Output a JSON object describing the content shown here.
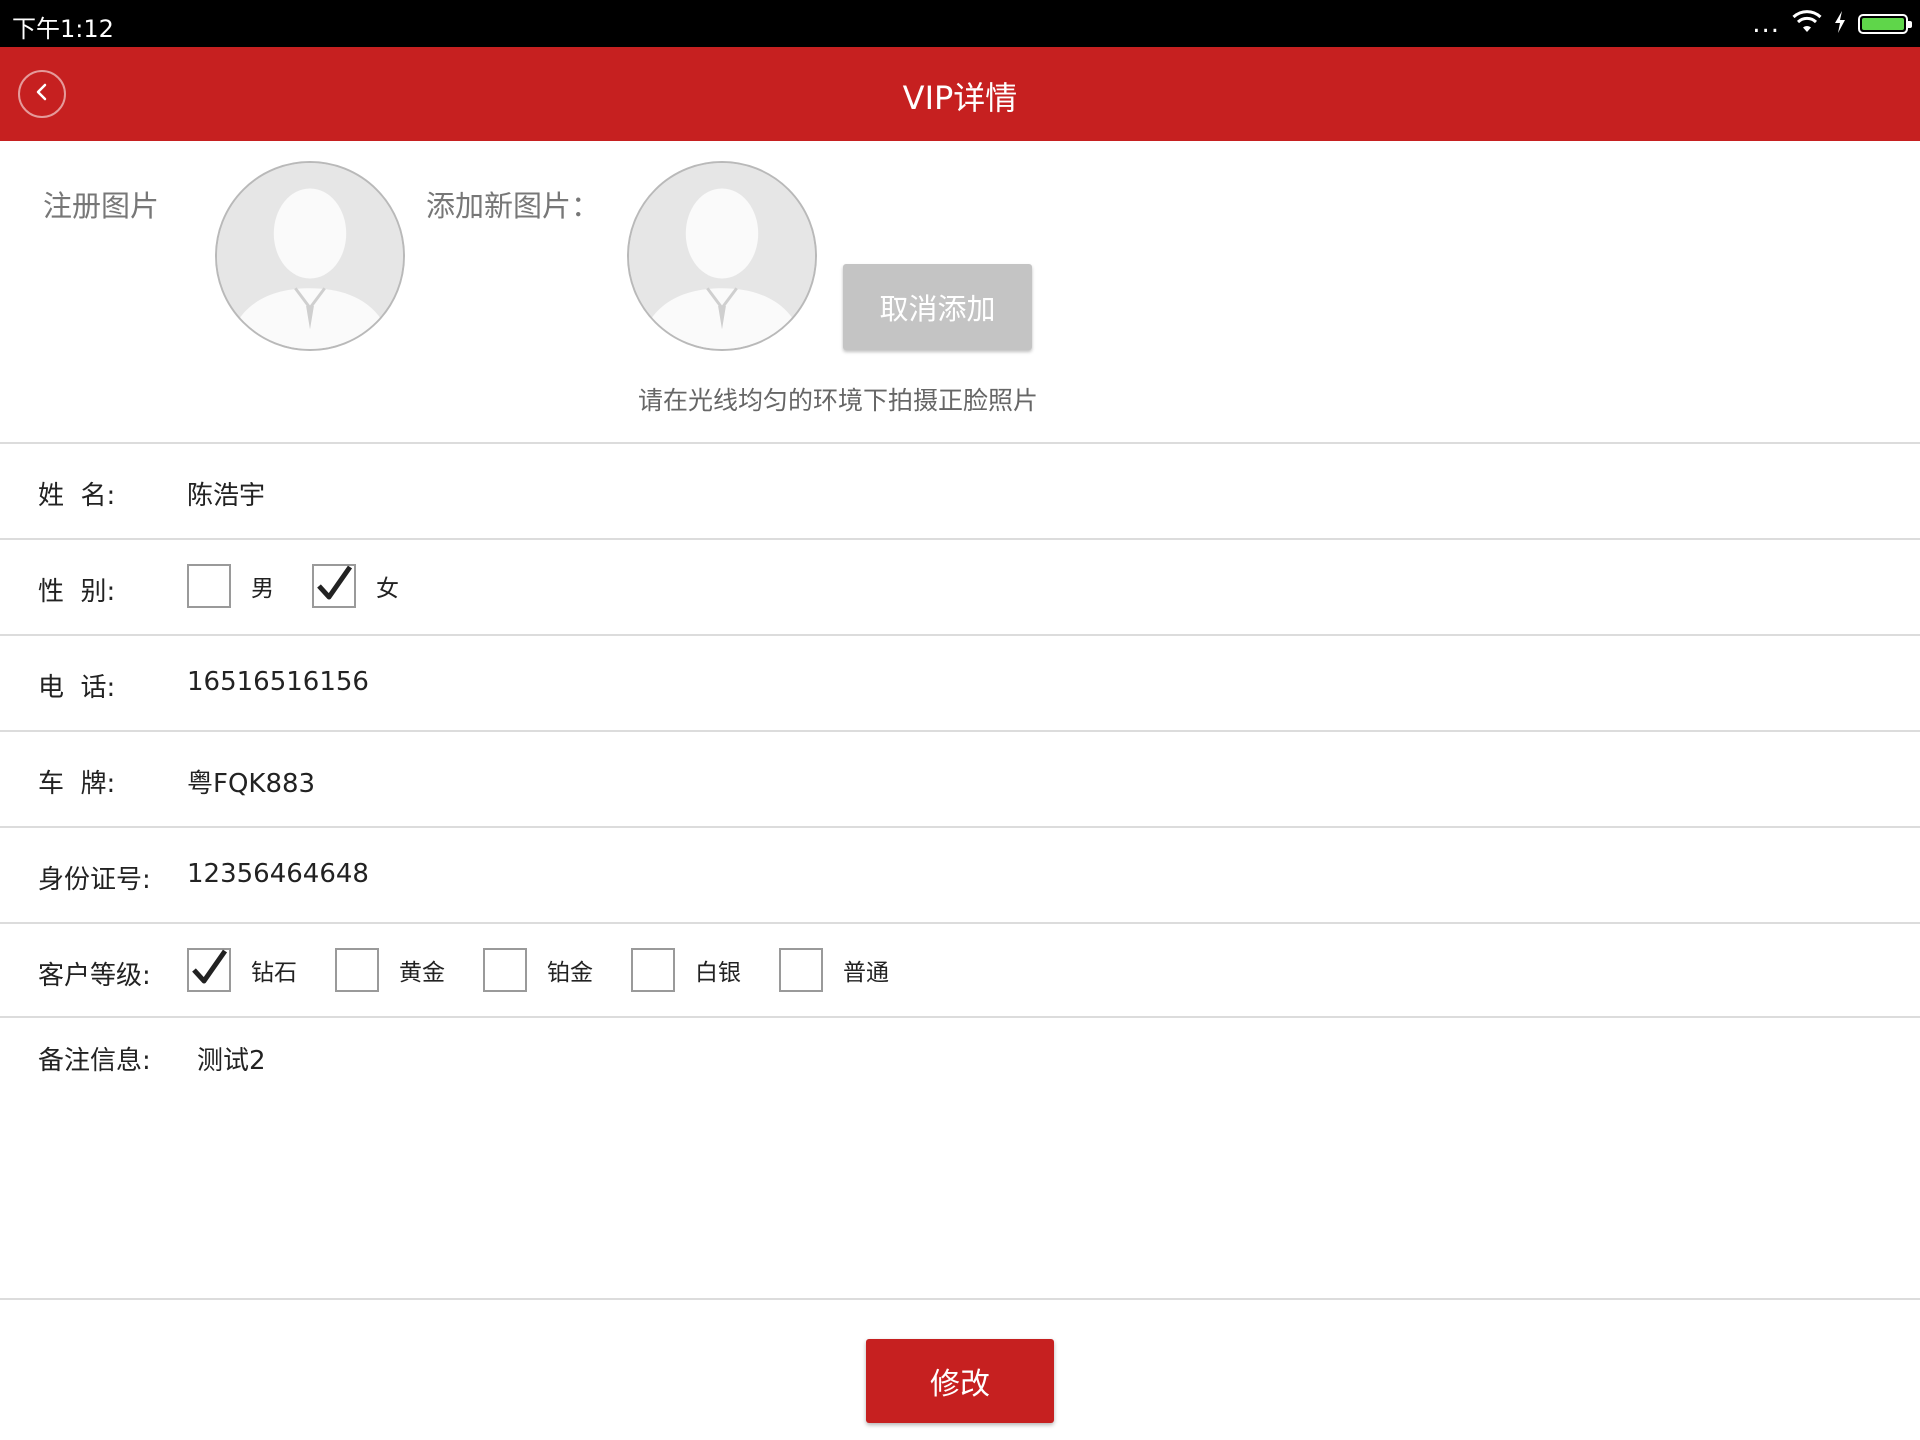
{
  "status_bar": {
    "time": "下午1:12",
    "more": "..."
  },
  "header": {
    "title": "VIP详情"
  },
  "photos": {
    "registered_label": "注册图片",
    "add_label": "添加新图片：",
    "cancel_button": "取消添加",
    "hint": "请在光线均匀的环境下拍摄正脸照片"
  },
  "form": {
    "name": {
      "label": "姓  名:",
      "value": "陈浩宇"
    },
    "gender": {
      "label": "性  别:",
      "options": [
        {
          "label": "男",
          "checked": false
        },
        {
          "label": "女",
          "checked": true
        }
      ]
    },
    "phone": {
      "label": "电  话:",
      "value": "16516516156"
    },
    "plate": {
      "label": "车  牌:",
      "value": "粤FQK883"
    },
    "id_number": {
      "label": "身份证号:",
      "value": "12356464648"
    },
    "level": {
      "label": "客户等级:",
      "options": [
        {
          "label": "钻石",
          "checked": true
        },
        {
          "label": "黄金",
          "checked": false
        },
        {
          "label": "铂金",
          "checked": false
        },
        {
          "label": "白银",
          "checked": false
        },
        {
          "label": "普通",
          "checked": false
        }
      ]
    },
    "remark": {
      "label": "备注信息:",
      "value": "测试2"
    }
  },
  "actions": {
    "modify_button": "修改"
  },
  "colors": {
    "primary": "#c62020",
    "battery": "#5fd64a",
    "disabled_button": "#c4c4c4"
  }
}
